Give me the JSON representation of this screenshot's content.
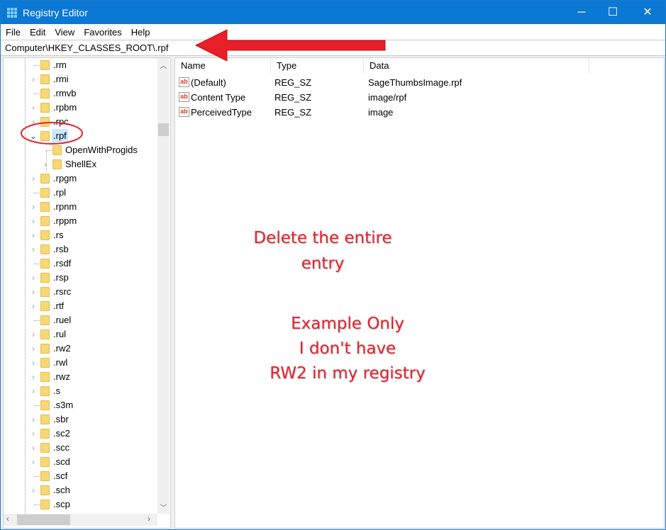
{
  "window": {
    "title": "Registry Editor",
    "minimize": "─",
    "maximize": "☐",
    "close": "✕"
  },
  "menu": [
    "File",
    "Edit",
    "View",
    "Favorites",
    "Help"
  ],
  "address": "Computer\\HKEY_CLASSES_ROOT\\.rpf",
  "tree": [
    {
      "label": ".rm",
      "exp": false,
      "level": 0
    },
    {
      "label": ".rmi",
      "exp": true,
      "level": 0
    },
    {
      "label": ".rmvb",
      "exp": false,
      "level": 0
    },
    {
      "label": ".rpbm",
      "exp": true,
      "level": 0
    },
    {
      "label": ".rpc",
      "exp": true,
      "level": 0
    },
    {
      "label": ".rpf",
      "exp": "open",
      "level": 0,
      "selected": true
    },
    {
      "label": "OpenWithProgids",
      "exp": false,
      "level": 1
    },
    {
      "label": "ShellEx",
      "exp": true,
      "level": 1
    },
    {
      "label": ".rpgm",
      "exp": true,
      "level": 0
    },
    {
      "label": ".rpl",
      "exp": false,
      "level": 0
    },
    {
      "label": ".rpnm",
      "exp": true,
      "level": 0
    },
    {
      "label": ".rppm",
      "exp": true,
      "level": 0
    },
    {
      "label": ".rs",
      "exp": true,
      "level": 0
    },
    {
      "label": ".rsb",
      "exp": true,
      "level": 0
    },
    {
      "label": ".rsdf",
      "exp": false,
      "level": 0
    },
    {
      "label": ".rsp",
      "exp": true,
      "level": 0
    },
    {
      "label": ".rsrc",
      "exp": true,
      "level": 0
    },
    {
      "label": ".rtf",
      "exp": true,
      "level": 0
    },
    {
      "label": ".ruel",
      "exp": false,
      "level": 0
    },
    {
      "label": ".rul",
      "exp": true,
      "level": 0
    },
    {
      "label": ".rw2",
      "exp": true,
      "level": 0
    },
    {
      "label": ".rwl",
      "exp": true,
      "level": 0
    },
    {
      "label": ".rwz",
      "exp": true,
      "level": 0
    },
    {
      "label": ".s",
      "exp": true,
      "level": 0
    },
    {
      "label": ".s3m",
      "exp": false,
      "level": 0
    },
    {
      "label": ".sbr",
      "exp": true,
      "level": 0
    },
    {
      "label": ".sc2",
      "exp": true,
      "level": 0
    },
    {
      "label": ".scc",
      "exp": true,
      "level": 0
    },
    {
      "label": ".scd",
      "exp": true,
      "level": 0
    },
    {
      "label": ".scf",
      "exp": false,
      "level": 0
    },
    {
      "label": ".sch",
      "exp": true,
      "level": 0
    },
    {
      "label": ".scp",
      "exp": false,
      "level": 0
    }
  ],
  "columns": [
    "Name",
    "Type",
    "Data"
  ],
  "values": [
    {
      "name": "(Default)",
      "type": "REG_SZ",
      "data": "SageThumbsImage.rpf"
    },
    {
      "name": "Content Type",
      "type": "REG_SZ",
      "data": "image/rpf"
    },
    {
      "name": "PerceivedType",
      "type": "REG_SZ",
      "data": "image"
    }
  ],
  "value_icon": "ab",
  "annotations": {
    "note1": [
      "Delete the entire",
      "entry"
    ],
    "note2": [
      "Example Only",
      "I don't have",
      "RW2 in my registry"
    ],
    "color": "#e8202a"
  }
}
